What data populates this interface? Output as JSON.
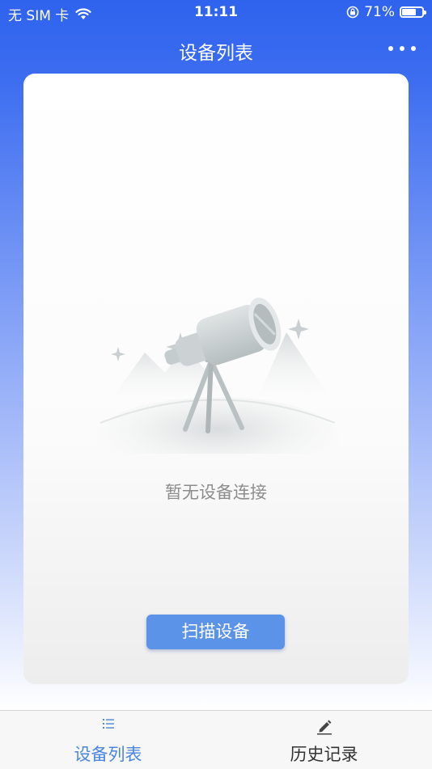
{
  "status_bar": {
    "carrier": "无 SIM 卡",
    "time": "11:11",
    "battery_percent": "71%",
    "battery_level": 0.71
  },
  "nav": {
    "title": "设备列表"
  },
  "card": {
    "empty_message": "暂无设备连接",
    "scan_button": "扫描设备"
  },
  "tabs": [
    {
      "label": "设备列表",
      "icon": "list-icon",
      "active": true
    },
    {
      "label": "历史记录",
      "icon": "pencil-icon",
      "active": false
    }
  ],
  "colors": {
    "primary": "#2f63ee",
    "button": "#5b93e8",
    "active_tab": "#4a86e0"
  }
}
